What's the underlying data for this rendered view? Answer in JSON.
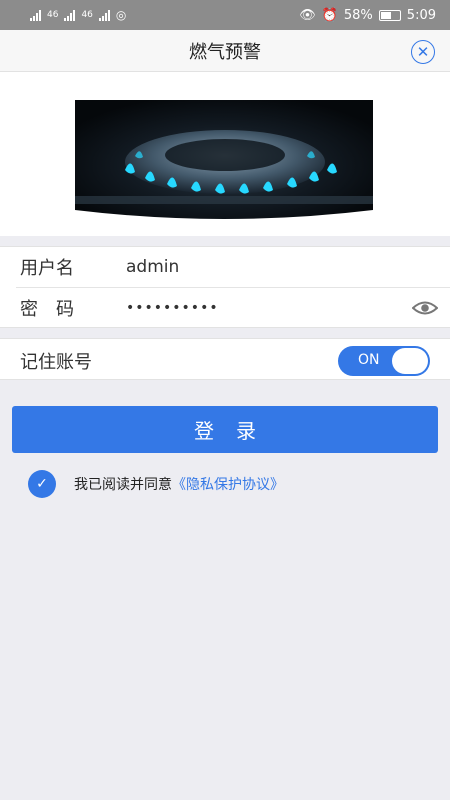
{
  "status_bar": {
    "network_left": "46",
    "network_right": "46",
    "battery": "58%",
    "time": "5:09"
  },
  "header": {
    "title": "燃气预警",
    "close_icon": "close-circle-icon"
  },
  "hero": {
    "image": "gas-stove-flame"
  },
  "form": {
    "username_label": "用户名",
    "username_value": "admin",
    "password_label": "密　码",
    "password_value": "••••••••••",
    "toggle_visibility_icon": "eye-icon"
  },
  "remember": {
    "label": "记住账号",
    "toggle_text": "ON"
  },
  "login_button": "登录",
  "agreement": {
    "text": "我已阅读并同意",
    "link": "《隐私保护协议》"
  },
  "colors": {
    "accent": "#3478e6",
    "background": "#ededf2"
  }
}
